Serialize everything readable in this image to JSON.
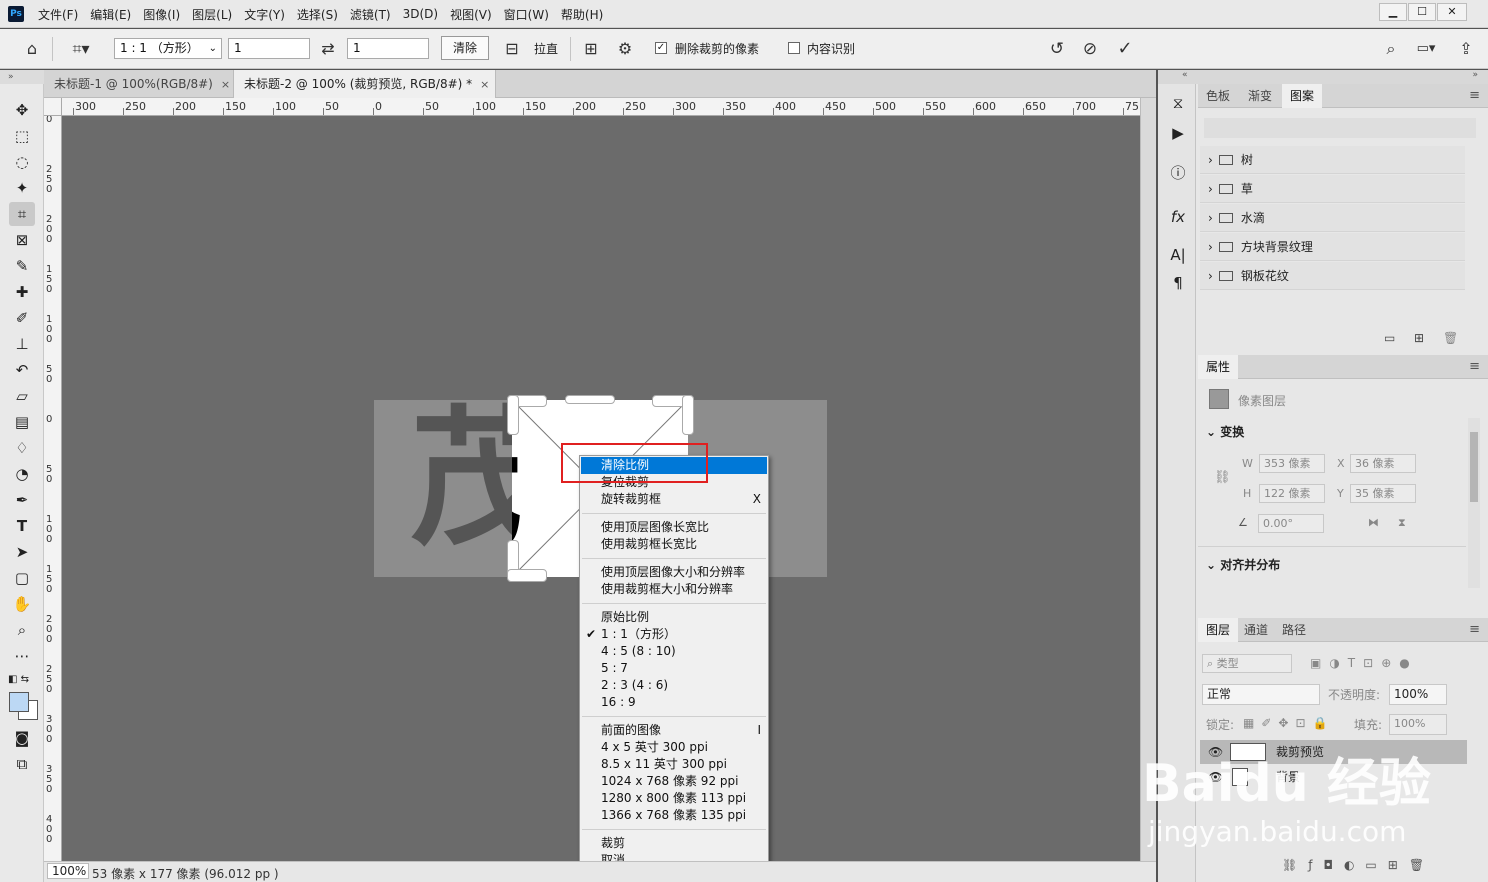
{
  "menubar": {
    "items": [
      "文件(F)",
      "编辑(E)",
      "图像(I)",
      "图层(L)",
      "文字(Y)",
      "选择(S)",
      "滤镜(T)",
      "3D(D)",
      "视图(V)",
      "窗口(W)",
      "帮助(H)"
    ],
    "logo": "Ps"
  },
  "window_controls": {
    "minimize": "▁",
    "restore": "☐",
    "close": "✕"
  },
  "options": {
    "ratio_select": "1 : 1 （方形）",
    "width_value": "1",
    "height_value": "1",
    "clear_label": "清除",
    "straighten_label": "拉直",
    "delete_cropped_label": "删除裁剪的像素",
    "delete_cropped_checked": true,
    "content_aware_label": "内容识别",
    "content_aware_checked": false
  },
  "tabs": [
    {
      "label": "未标题-1 @ 100%(RGB/8#)",
      "active": false
    },
    {
      "label": "未标题-2 @ 100% (裁剪预览, RGB/8#) *",
      "active": true
    }
  ],
  "ruler_h_labels": [
    "300",
    "250",
    "200",
    "150",
    "100",
    "50",
    "0",
    "50",
    "100",
    "150",
    "200",
    "250",
    "300",
    "350",
    "400",
    "450",
    "500",
    "550",
    "600",
    "650",
    "700",
    "75"
  ],
  "ruler_v_labels": [
    "0",
    "2\n5\n0",
    "2\n0\n0",
    "1\n5\n0",
    "1\n0\n0",
    "5\n0",
    "0",
    "5\n0",
    "1\n0\n0",
    "1\n5\n0",
    "2\n0\n0",
    "2\n5\n0",
    "3\n0\n0",
    "3\n5\n0",
    "4\n0\n0",
    "4"
  ],
  "status": {
    "zoom": "100%",
    "info": "53 像素 x 177 像素 (96.012 pp )"
  },
  "canvas": {
    "bg_text": "茂",
    "crop_text": "茂"
  },
  "context_menu": {
    "groups": [
      [
        {
          "label": "清除比例",
          "highlight": true
        },
        {
          "label": "复位裁剪"
        },
        {
          "label": "旋转裁剪框",
          "shortcut": "X"
        }
      ],
      [
        {
          "label": "使用顶层图像长宽比"
        },
        {
          "label": "使用裁剪框长宽比"
        }
      ],
      [
        {
          "label": "使用顶层图像大小和分辨率"
        },
        {
          "label": "使用裁剪框大小和分辨率"
        }
      ],
      [
        {
          "label": "原始比例"
        },
        {
          "label": "1 : 1（方形）",
          "checked": true
        },
        {
          "label": "4 : 5 (8 : 10)"
        },
        {
          "label": "5 : 7"
        },
        {
          "label": "2 : 3 (4 : 6)"
        },
        {
          "label": "16 : 9"
        }
      ],
      [
        {
          "label": "前面的图像",
          "shortcut": "I"
        },
        {
          "label": "4 x 5 英寸 300 ppi"
        },
        {
          "label": "8.5 x 11 英寸 300 ppi"
        },
        {
          "label": "1024 x 768 像素 92 ppi"
        },
        {
          "label": "1280 x 800 像素 113 ppi"
        },
        {
          "label": "1366 x 768 像素 135 ppi"
        }
      ],
      [
        {
          "label": "裁剪"
        },
        {
          "label": "取消"
        }
      ]
    ]
  },
  "patterns_panel": {
    "tabs": [
      "色板",
      "渐变",
      "图案"
    ],
    "active_tab": "图案",
    "folders": [
      "树",
      "草",
      "水滴",
      "方块背景纹理",
      "钢板花纹"
    ]
  },
  "properties_panel": {
    "title": "属性",
    "layer_type": "像素图层",
    "transform_title": "变换",
    "w_label": "W",
    "w_value": "353 像素",
    "x_label": "X",
    "x_value": "36 像素",
    "h_label": "H",
    "h_value": "122 像素",
    "y_label": "Y",
    "y_value": "35 像素",
    "angle_value": "0.00°",
    "align_title": "对齐并分布"
  },
  "layers_panel": {
    "tabs": [
      "图层",
      "通道",
      "路径"
    ],
    "filter_label": "类型",
    "blend_mode": "正常",
    "opacity_label": "不透明度:",
    "opacity_value": "100%",
    "lock_label": "锁定:",
    "fill_label": "填充:",
    "fill_value": "100%",
    "layers": [
      {
        "name": "裁剪预览",
        "visible": true,
        "selected": true
      },
      {
        "name": "背景",
        "visible": true,
        "selected": false
      }
    ]
  },
  "watermark": {
    "line1": "Baidu 经验",
    "line2": "jingyan.baidu.com"
  },
  "colors": {
    "highlight": "#0078d7",
    "annotation_box": "#e02020",
    "canvas_bg": "#6b6b6b"
  }
}
